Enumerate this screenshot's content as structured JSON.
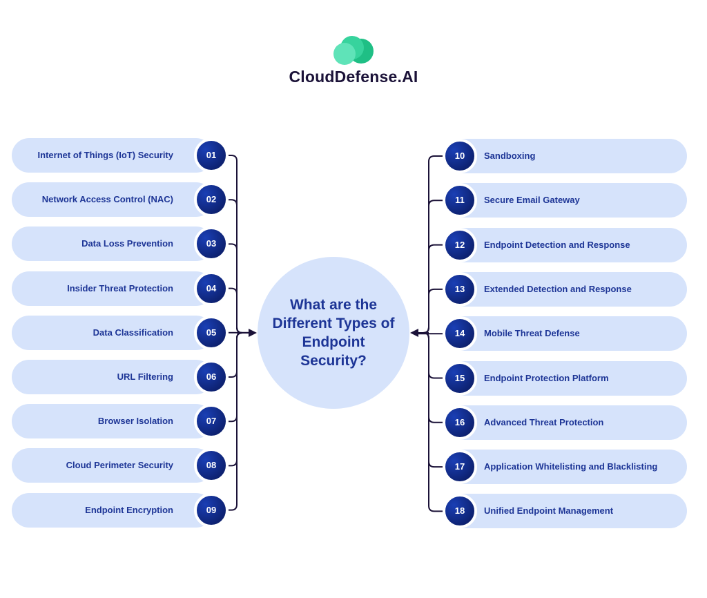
{
  "brand": {
    "name": "CloudDefense.AI",
    "logo_icon": "cloud-icon",
    "colors": {
      "cloud_light": "#5fe3b8",
      "cloud_dark": "#1fbf85",
      "text": "#1b1238"
    }
  },
  "center": {
    "title": "What are the Different Types of Endpoint Security?"
  },
  "colors": {
    "pill": "#d6e3fb",
    "label": "#1d3596",
    "badge": "#0d2170",
    "connector": "#1b1238"
  },
  "left_items": [
    {
      "num": "01",
      "label": "Internet of Things (IoT) Security"
    },
    {
      "num": "02",
      "label": "Network Access Control (NAC)"
    },
    {
      "num": "03",
      "label": "Data Loss Prevention"
    },
    {
      "num": "04",
      "label": "Insider Threat Protection"
    },
    {
      "num": "05",
      "label": "Data Classification"
    },
    {
      "num": "06",
      "label": "URL Filtering"
    },
    {
      "num": "07",
      "label": "Browser Isolation"
    },
    {
      "num": "08",
      "label": "Cloud Perimeter Security"
    },
    {
      "num": "09",
      "label": "Endpoint Encryption"
    }
  ],
  "right_items": [
    {
      "num": "10",
      "label": "Sandboxing"
    },
    {
      "num": "11",
      "label": "Secure Email Gateway"
    },
    {
      "num": "12",
      "label": "Endpoint Detection and Response"
    },
    {
      "num": "13",
      "label": "Extended Detection and Response"
    },
    {
      "num": "14",
      "label": "Mobile Threat Defense"
    },
    {
      "num": "15",
      "label": "Endpoint Protection Platform"
    },
    {
      "num": "16",
      "label": "Advanced Threat Protection"
    },
    {
      "num": "17",
      "label": "Application Whitelisting and Blacklisting"
    },
    {
      "num": "18",
      "label": "Unified Endpoint Management"
    }
  ]
}
